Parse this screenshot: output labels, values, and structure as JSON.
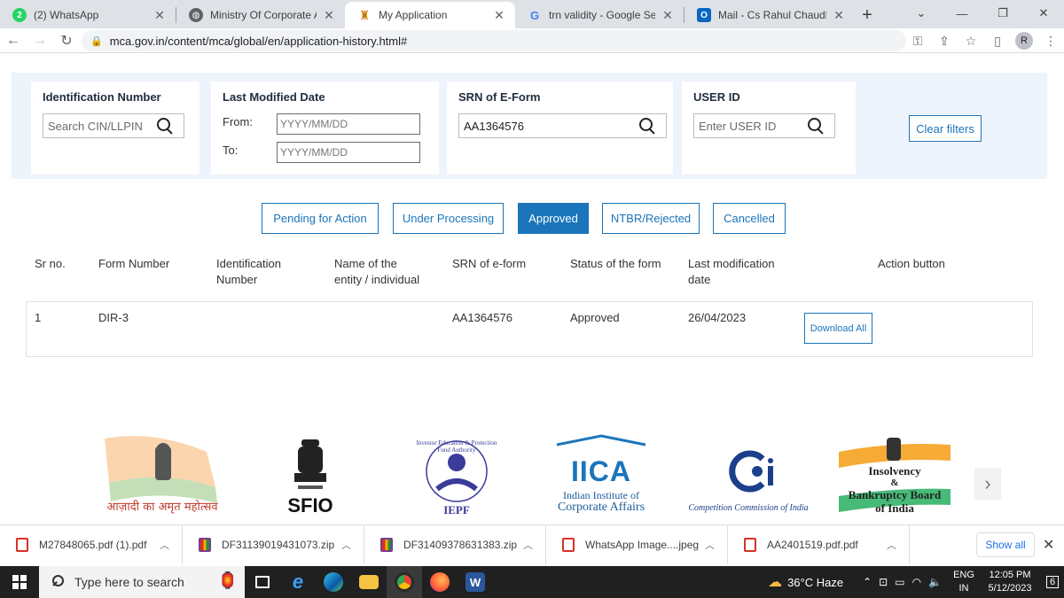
{
  "browser": {
    "tabs": [
      {
        "title": "(2) WhatsApp",
        "badge": "2",
        "active": false
      },
      {
        "title": "Ministry Of Corporate Affairs",
        "active": false
      },
      {
        "title": "My Application",
        "active": true
      },
      {
        "title": "trn validity - Google Search",
        "active": false
      },
      {
        "title": "Mail - Cs Rahul Chaudhary -",
        "active": false
      }
    ],
    "new_tab": "+",
    "url": "mca.gov.in/content/mca/global/en/application-history.html#",
    "avatar_letter": "R"
  },
  "filters": {
    "identification_number": {
      "label": "Identification Number",
      "placeholder": "Search CIN/LLPIN"
    },
    "last_modified_date": {
      "label": "Last Modified Date",
      "from_label": "From:",
      "to_label": "To:",
      "from_placeholder": "YYYY/MM/DD",
      "to_placeholder": "YYYY/MM/DD"
    },
    "srn": {
      "label": "SRN of E-Form",
      "value": "AA1364576"
    },
    "user_id": {
      "label": "USER ID",
      "placeholder": "Enter USER ID"
    },
    "clear_label": "Clear filters"
  },
  "status_tabs": [
    {
      "label": "Pending for Action",
      "active": false
    },
    {
      "label": "Under Processing",
      "active": false
    },
    {
      "label": "Approved",
      "active": true
    },
    {
      "label": "NTBR/Rejected",
      "active": false
    },
    {
      "label": "Cancelled",
      "active": false
    }
  ],
  "table": {
    "headers": {
      "sr": "Sr no.",
      "form": "Form Number",
      "ident_1": "Identification",
      "ident_2": "Number",
      "name_1": "Name of the",
      "name_2": "entity / individual",
      "srn": "SRN of e-form",
      "status": "Status of the form",
      "lastmod_1": "Last modification",
      "lastmod_2": "date",
      "action": "Action button"
    },
    "rows": [
      {
        "sr": "1",
        "form": "DIR-3",
        "identification": "",
        "name": "",
        "srn": "AA1364576",
        "status": "Approved",
        "last_modified": "26/04/2023",
        "action": "Download All"
      }
    ]
  },
  "logos": {
    "azadi": "आज़ादी का अमृत महोत्सव",
    "sfio": "SFIO",
    "iepf": "IEPF",
    "iepf_ring": "Investor Education & Protection Fund Authority",
    "iica_abbr": "IICA",
    "iica_1": "Indian Institute of",
    "iica_2": "Corporate Affairs",
    "cci": "Competition Commission of India",
    "ibbi_1": "Insolvency",
    "ibbi_2": "&",
    "ibbi_3": "Bankruptcy Board",
    "ibbi_4": "of India"
  },
  "downloads": {
    "items": [
      {
        "name": "M27848065.pdf (1).pdf",
        "type": "pdf"
      },
      {
        "name": "DF31139019431073.zip",
        "type": "zip"
      },
      {
        "name": "DF31409378631383.zip",
        "type": "zip"
      },
      {
        "name": "WhatsApp Image....jpeg",
        "type": "img"
      },
      {
        "name": "AA2401519.pdf.pdf",
        "type": "pdf"
      }
    ],
    "show_all": "Show all"
  },
  "taskbar": {
    "search_placeholder": "Type here to search",
    "weather": "36°C  Haze",
    "lang_1": "ENG",
    "lang_2": "IN",
    "time": "12:05 PM",
    "date": "5/12/2023",
    "notifications": "6"
  },
  "colors": {
    "accent": "#1b75bb",
    "panel": "#eef4fb"
  }
}
